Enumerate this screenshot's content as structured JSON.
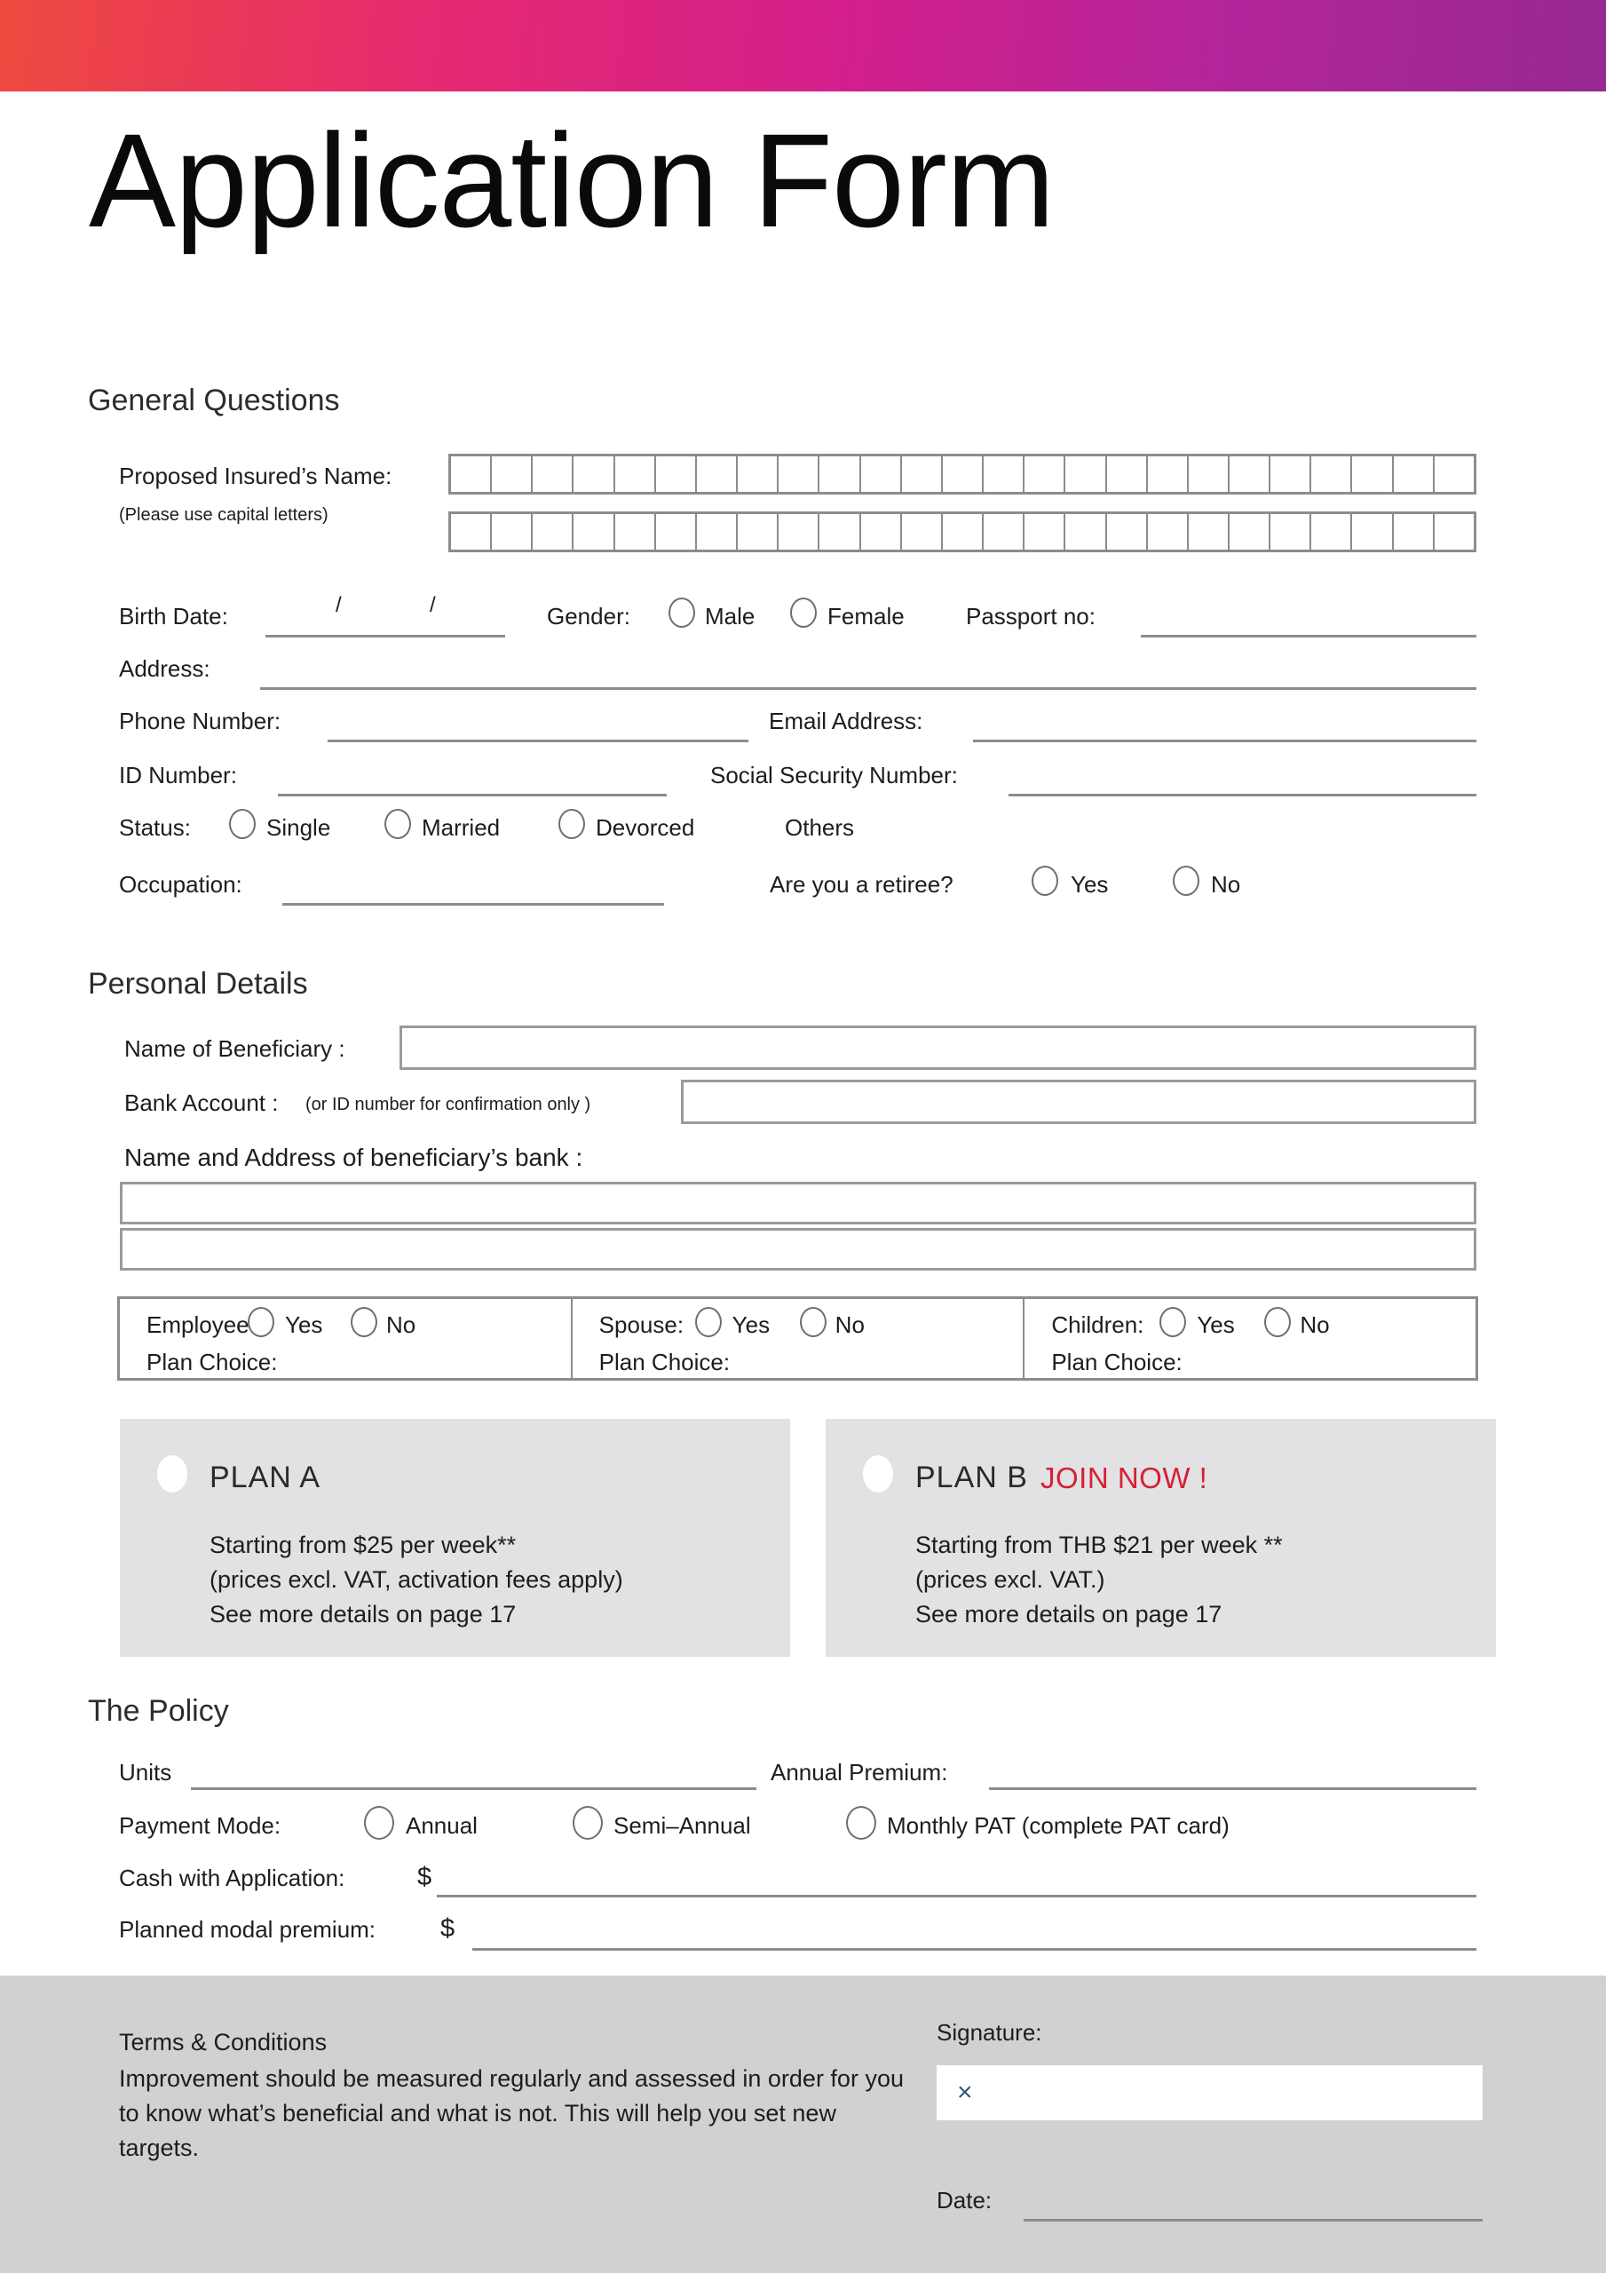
{
  "header": {
    "accent_left": "#ef4a3e",
    "accent_mid": "#d41f8c",
    "accent_right": "#96288f"
  },
  "title": "Application Form",
  "sections": {
    "general": "General Questions",
    "personal": "Personal Details",
    "policy": "The Policy"
  },
  "general": {
    "name_label": "Proposed Insured’s Name:",
    "name_hint": "(Please use capital letters)",
    "name_cells_row1": 25,
    "name_cells_row2": 25,
    "birth_date_label": "Birth Date:",
    "birth_date_sep1": "/",
    "birth_date_sep2": "/",
    "gender_label": "Gender:",
    "gender_male": "Male",
    "gender_female": "Female",
    "passport_label": "Passport no:",
    "address_label": "Address:",
    "phone_label": "Phone Number:",
    "email_label": "Email Address:",
    "id_label": "ID Number:",
    "ssn_label": "Social Security  Number:",
    "status_label": "Status:",
    "status_single": "Single",
    "status_married": "Married",
    "status_divorced": "Devorced",
    "status_others": "Others",
    "occupation_label": "Occupation:",
    "retiree_label": "Are you a retiree?",
    "retiree_yes": "Yes",
    "retiree_no": "No"
  },
  "personal": {
    "beneficiary_label": "Name of Beneficiary :",
    "bank_account_label": "Bank Account :",
    "bank_account_note": "(or ID number for confirmation only )",
    "bank_address_label": "Name and Address of beneficiary’s bank :",
    "coverage": [
      {
        "name": "Employee:",
        "yes": "Yes",
        "no": "No",
        "plan_choice": "Plan Choice:"
      },
      {
        "name": "Spouse:",
        "yes": "Yes",
        "no": "No",
        "plan_choice": "Plan Choice:"
      },
      {
        "name": "Children:",
        "yes": "Yes",
        "no": "No",
        "plan_choice": "Plan Choice:"
      }
    ],
    "plans": [
      {
        "title": "PLAN A",
        "badge": "",
        "line1": "Starting from $25 per week**",
        "line2": "(prices excl. VAT, activation fees apply)",
        "line3": "See more details on page 17"
      },
      {
        "title": "PLAN B",
        "badge": "JOIN NOW !",
        "line1": "Starting from THB $21 per week **",
        "line2": "(prices excl. VAT.)",
        "line3": "See more details on page 17"
      }
    ],
    "badge_color": "#d81f33"
  },
  "policy": {
    "units_label": "Units",
    "annual_premium_label": "Annual Premium:",
    "payment_mode_label": "Payment Mode:",
    "mode_annual": "Annual",
    "mode_semi_annual": "Semi–Annual",
    "mode_monthly_pat": "Monthly PAT (complete PAT card)",
    "cash_label": "Cash with Application:",
    "cash_currency": "$",
    "planned_label": "Planned modal premium:",
    "planned_currency": "$"
  },
  "footer": {
    "terms_title": "Terms & Conditions",
    "terms_body": "Improvement should be measured regularly and assessed in order for you to know what’s beneficial and what is not. This will help you set new targets.",
    "signature_label": "Signature:",
    "signature_mark": "×",
    "date_label": "Date:"
  }
}
